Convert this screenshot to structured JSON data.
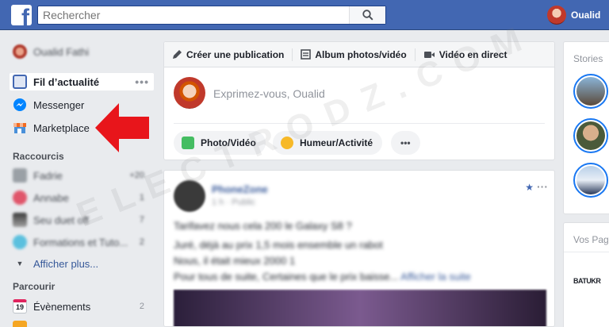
{
  "topbar": {
    "logo_letter": "f",
    "search_placeholder": "Rechercher",
    "user_name": "Oualid"
  },
  "leftnav": {
    "profile_name": "Oualid Fathi",
    "main_items": [
      {
        "label": "Fil d’actualité",
        "more": "•••"
      },
      {
        "label": "Messenger"
      },
      {
        "label": "Marketplace"
      }
    ],
    "shortcuts_title": "Raccourcis",
    "shortcuts": [
      {
        "label": "Fadrie",
        "count": "+20"
      },
      {
        "label": "Annabe",
        "count": "1"
      },
      {
        "label": "Seu duet off",
        "count": "7"
      },
      {
        "label": "Formations et Tuto...",
        "count": "2"
      }
    ],
    "see_more": "Afficher plus...",
    "explore_title": "Parcourir",
    "explore": [
      {
        "label": "Évènements",
        "count": "2",
        "calendar_day": "19"
      }
    ]
  },
  "composer": {
    "tabs": [
      {
        "label": "Créer une publication",
        "icon": "pencil-icon"
      },
      {
        "label": "Album photos/vidéo",
        "icon": "album-icon"
      },
      {
        "label": "Vidéo en direct",
        "icon": "video-camera-icon"
      }
    ],
    "placeholder": "Exprimez-vous, Oualid",
    "actions": [
      {
        "label": "Photo/Vidéo",
        "icon": "photo-icon"
      },
      {
        "label": "Humeur/Activité",
        "icon": "smiley-icon"
      },
      {
        "label": "•••"
      }
    ]
  },
  "post": {
    "author": "PhoneZone",
    "meta": "1 h · Public",
    "lines": [
      "Tarifavez nous cela 200 le Galaxy S8 ?",
      "Juré, déjà au prix 1,5 mois ensemble un rabot",
      "Nous, il était mieux 2000 1",
      "Pour tous de suite, Certaines que le prix baisse..."
    ],
    "see_more": "Afficher la suite"
  },
  "right": {
    "stories_title": "Stories",
    "pages_title": "Vos Pages",
    "pages_logo": "BATUKR"
  },
  "watermark": "ELECTRODZ.COM",
  "colors": {
    "brand_blue": "#4267b2",
    "arrow_red": "#e8151b",
    "page_bg": "#e9ebee"
  }
}
